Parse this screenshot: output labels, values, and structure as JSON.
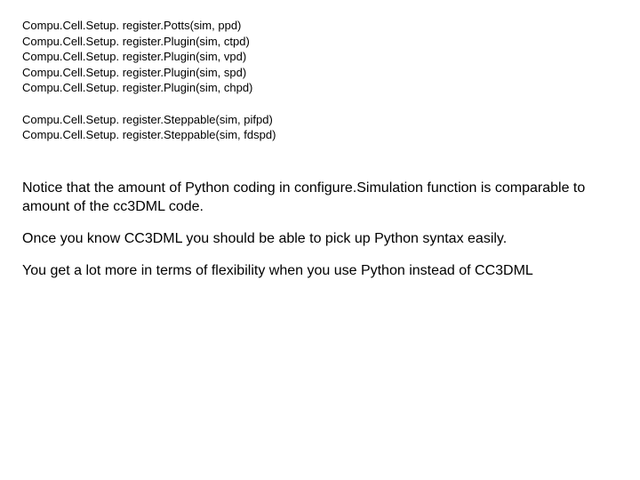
{
  "code_block_1": {
    "lines": [
      "Compu.Cell.Setup. register.Potts(sim, ppd)",
      "Compu.Cell.Setup. register.Plugin(sim, ctpd)",
      "Compu.Cell.Setup. register.Plugin(sim, vpd)",
      "Compu.Cell.Setup. register.Plugin(sim, spd)",
      "Compu.Cell.Setup. register.Plugin(sim, chpd)"
    ]
  },
  "code_block_2": {
    "lines": [
      "Compu.Cell.Setup. register.Steppable(sim, pifpd)",
      "Compu.Cell.Setup. register.Steppable(sim, fdspd)"
    ]
  },
  "paragraphs": {
    "p1": "Notice that the amount of Python coding in configure.Simulation function is comparable to amount of the cc3DML code.",
    "p2": "Once you know CC3DML you should be able to pick up Python syntax easily.",
    "p3": "You get a lot more in terms of flexibility when you use Python instead of CC3DML"
  }
}
